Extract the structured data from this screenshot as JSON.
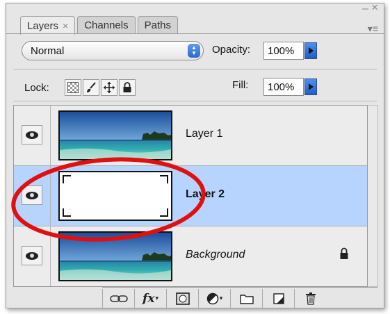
{
  "panel": {
    "tabs": [
      {
        "label": "Layers",
        "close": "×",
        "active": true
      },
      {
        "label": "Channels",
        "active": false
      },
      {
        "label": "Paths",
        "active": false
      }
    ],
    "window_minimize": "–",
    "window_close": "×",
    "menu_glyph": "▾≡"
  },
  "controls": {
    "blend_mode": "Normal",
    "opacity_label": "Opacity:",
    "opacity_value": "100%",
    "lock_label": "Lock:",
    "fill_label": "Fill:",
    "fill_value": "100%"
  },
  "layers": [
    {
      "name": "Layer 1",
      "thumbnail": "beach-photo",
      "visible": true,
      "selected": false
    },
    {
      "name": "Layer 2",
      "thumbnail": "white-mask",
      "visible": true,
      "selected": true
    },
    {
      "name": "Background",
      "thumbnail": "beach-photo",
      "visible": true,
      "selected": false,
      "locked": true
    }
  ],
  "bottom_bar": {
    "fx_label": "fx"
  },
  "icons": {
    "lock_pixels": "lock-transparent-pixels-icon",
    "lock_image": "brush-icon",
    "lock_position": "move-icon",
    "lock_all": "padlock-icon",
    "layer_visibility": "eye-icon"
  },
  "colors": {
    "selected_row": "#b6d4ff",
    "annotation_ellipse": "#e01010",
    "accent_button": "#2c68c8"
  }
}
